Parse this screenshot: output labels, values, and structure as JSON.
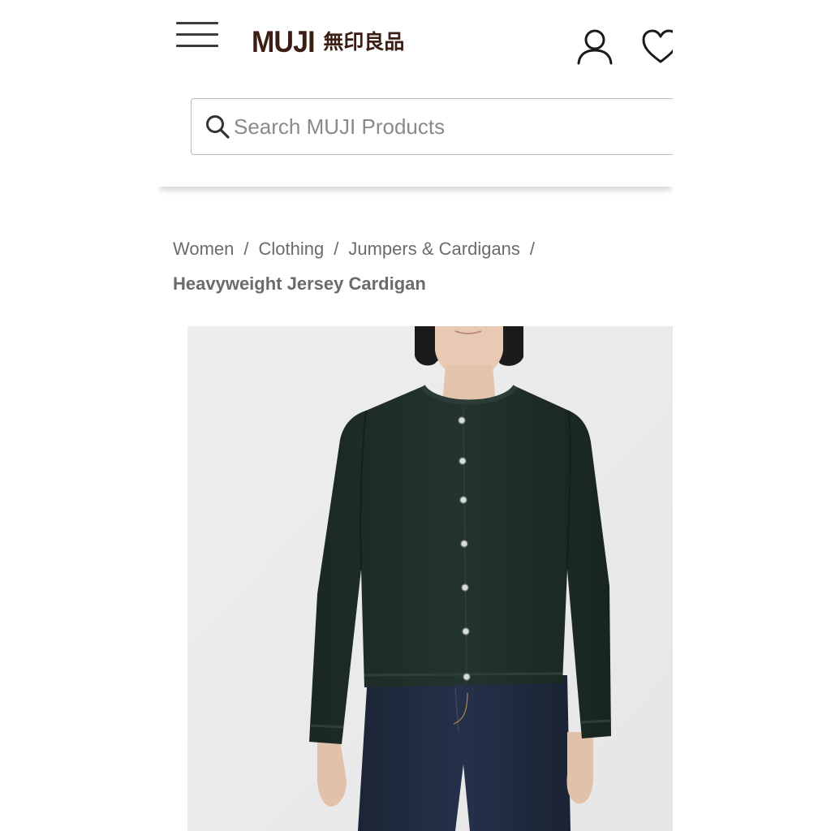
{
  "header": {
    "menu_icon": "hamburger-menu-icon",
    "logo": {
      "latin": "MUJI",
      "japanese": "無印良品"
    },
    "account_icon": "user-account-icon",
    "favorites_icon": "heart-icon"
  },
  "search": {
    "placeholder": "Search MUJI Products",
    "value": "",
    "icon": "search-icon"
  },
  "breadcrumb": {
    "items": [
      "Women",
      "Clothing",
      "Jumpers & Cardigans"
    ],
    "separator": "/",
    "current": "Heavyweight Jersey Cardigan"
  },
  "product": {
    "image_alt": "Heavyweight Jersey Cardigan",
    "garment_color": "#1f2e29",
    "background_color": "#ececec"
  },
  "colors": {
    "logo": "#3c1f14",
    "text_muted": "#6b6b6b",
    "border": "#bdbdbd"
  }
}
